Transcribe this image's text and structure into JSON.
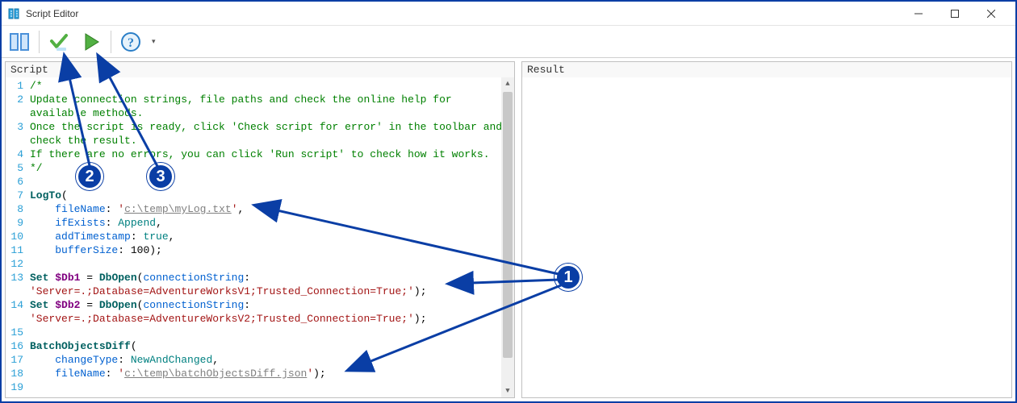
{
  "window": {
    "title": "Script Editor"
  },
  "toolbar": {
    "buttons": {
      "panel": "panel-toggle-icon",
      "check": "check-script-icon",
      "run": "run-script-icon",
      "help": "help-icon"
    }
  },
  "panes": {
    "script_header": "Script",
    "result_header": "Result"
  },
  "code": {
    "lines": [
      {
        "n": "1",
        "wrap": false,
        "tokens": [
          {
            "c": "tok-comment",
            "t": "/*"
          }
        ]
      },
      {
        "n": "2",
        "wrap": false,
        "tokens": [
          {
            "c": "tok-comment",
            "t": "Update connection strings, file paths and check the online help for"
          }
        ]
      },
      {
        "n": "",
        "wrap": true,
        "tokens": [
          {
            "c": "tok-comment",
            "t": "available methods."
          }
        ]
      },
      {
        "n": "3",
        "wrap": false,
        "tokens": [
          {
            "c": "tok-comment",
            "t": "Once the script is ready, click 'Check script for error' in the toolbar and"
          }
        ]
      },
      {
        "n": "",
        "wrap": true,
        "tokens": [
          {
            "c": "tok-comment",
            "t": "check the result."
          }
        ]
      },
      {
        "n": "4",
        "wrap": false,
        "tokens": [
          {
            "c": "tok-comment",
            "t": "If there are no errors, you can click 'Run script' to check how it works."
          }
        ]
      },
      {
        "n": "5",
        "wrap": false,
        "tokens": [
          {
            "c": "tok-comment",
            "t": "*/"
          }
        ]
      },
      {
        "n": "6",
        "wrap": false,
        "tokens": [
          {
            "c": "",
            "t": ""
          }
        ]
      },
      {
        "n": "7",
        "wrap": false,
        "tokens": [
          {
            "c": "tok-func",
            "t": "LogTo"
          },
          {
            "c": "",
            "t": "("
          }
        ]
      },
      {
        "n": "8",
        "wrap": false,
        "tokens": [
          {
            "c": "",
            "t": "    "
          },
          {
            "c": "tok-param",
            "t": "fileName"
          },
          {
            "c": "",
            "t": ": "
          },
          {
            "c": "tok-string",
            "t": "'"
          },
          {
            "c": "tok-url",
            "t": "c:\\temp\\myLog.txt"
          },
          {
            "c": "tok-string",
            "t": "'"
          },
          {
            "c": "",
            "t": ","
          }
        ]
      },
      {
        "n": "9",
        "wrap": false,
        "tokens": [
          {
            "c": "",
            "t": "    "
          },
          {
            "c": "tok-param",
            "t": "ifExists"
          },
          {
            "c": "",
            "t": ": "
          },
          {
            "c": "tok-ident",
            "t": "Append"
          },
          {
            "c": "",
            "t": ","
          }
        ]
      },
      {
        "n": "10",
        "wrap": false,
        "tokens": [
          {
            "c": "",
            "t": "    "
          },
          {
            "c": "tok-param",
            "t": "addTimestamp"
          },
          {
            "c": "",
            "t": ": "
          },
          {
            "c": "tok-ident",
            "t": "true"
          },
          {
            "c": "",
            "t": ","
          }
        ]
      },
      {
        "n": "11",
        "wrap": false,
        "tokens": [
          {
            "c": "",
            "t": "    "
          },
          {
            "c": "tok-param",
            "t": "bufferSize"
          },
          {
            "c": "",
            "t": ": "
          },
          {
            "c": "tok-num",
            "t": "100"
          },
          {
            "c": "",
            "t": ");"
          }
        ]
      },
      {
        "n": "12",
        "wrap": false,
        "tokens": [
          {
            "c": "",
            "t": ""
          }
        ]
      },
      {
        "n": "13",
        "wrap": false,
        "tokens": [
          {
            "c": "tok-kw",
            "t": "Set "
          },
          {
            "c": "tok-var",
            "t": "$Db1"
          },
          {
            "c": "",
            "t": " = "
          },
          {
            "c": "tok-func",
            "t": "DbOpen"
          },
          {
            "c": "",
            "t": "("
          },
          {
            "c": "tok-param",
            "t": "connectionString"
          },
          {
            "c": "",
            "t": ":"
          }
        ]
      },
      {
        "n": "",
        "wrap": true,
        "tokens": [
          {
            "c": "tok-string",
            "t": "'Server=.;Database=AdventureWorksV1;Trusted_Connection=True;'"
          },
          {
            "c": "",
            "t": ");"
          }
        ]
      },
      {
        "n": "14",
        "wrap": false,
        "tokens": [
          {
            "c": "tok-kw",
            "t": "Set "
          },
          {
            "c": "tok-var",
            "t": "$Db2"
          },
          {
            "c": "",
            "t": " = "
          },
          {
            "c": "tok-func",
            "t": "DbOpen"
          },
          {
            "c": "",
            "t": "("
          },
          {
            "c": "tok-param",
            "t": "connectionString"
          },
          {
            "c": "",
            "t": ":"
          }
        ]
      },
      {
        "n": "",
        "wrap": true,
        "tokens": [
          {
            "c": "tok-string",
            "t": "'Server=.;Database=AdventureWorksV2;Trusted_Connection=True;'"
          },
          {
            "c": "",
            "t": ");"
          }
        ]
      },
      {
        "n": "15",
        "wrap": false,
        "tokens": [
          {
            "c": "",
            "t": ""
          }
        ]
      },
      {
        "n": "16",
        "wrap": false,
        "tokens": [
          {
            "c": "tok-func",
            "t": "BatchObjectsDiff"
          },
          {
            "c": "",
            "t": "("
          }
        ]
      },
      {
        "n": "17",
        "wrap": false,
        "tokens": [
          {
            "c": "",
            "t": "    "
          },
          {
            "c": "tok-param",
            "t": "changeType"
          },
          {
            "c": "",
            "t": ": "
          },
          {
            "c": "tok-ident",
            "t": "NewAndChanged"
          },
          {
            "c": "",
            "t": ","
          }
        ]
      },
      {
        "n": "18",
        "wrap": false,
        "tokens": [
          {
            "c": "",
            "t": "    "
          },
          {
            "c": "tok-param",
            "t": "fileName"
          },
          {
            "c": "",
            "t": ": "
          },
          {
            "c": "tok-string",
            "t": "'"
          },
          {
            "c": "tok-url",
            "t": "c:\\temp\\batchObjectsDiff.json"
          },
          {
            "c": "tok-string",
            "t": "'"
          },
          {
            "c": "",
            "t": ");"
          }
        ]
      },
      {
        "n": "19",
        "wrap": false,
        "tokens": [
          {
            "c": "",
            "t": ""
          }
        ]
      }
    ]
  },
  "annotations": {
    "callout_1": "1",
    "callout_2": "2",
    "callout_3": "3"
  }
}
